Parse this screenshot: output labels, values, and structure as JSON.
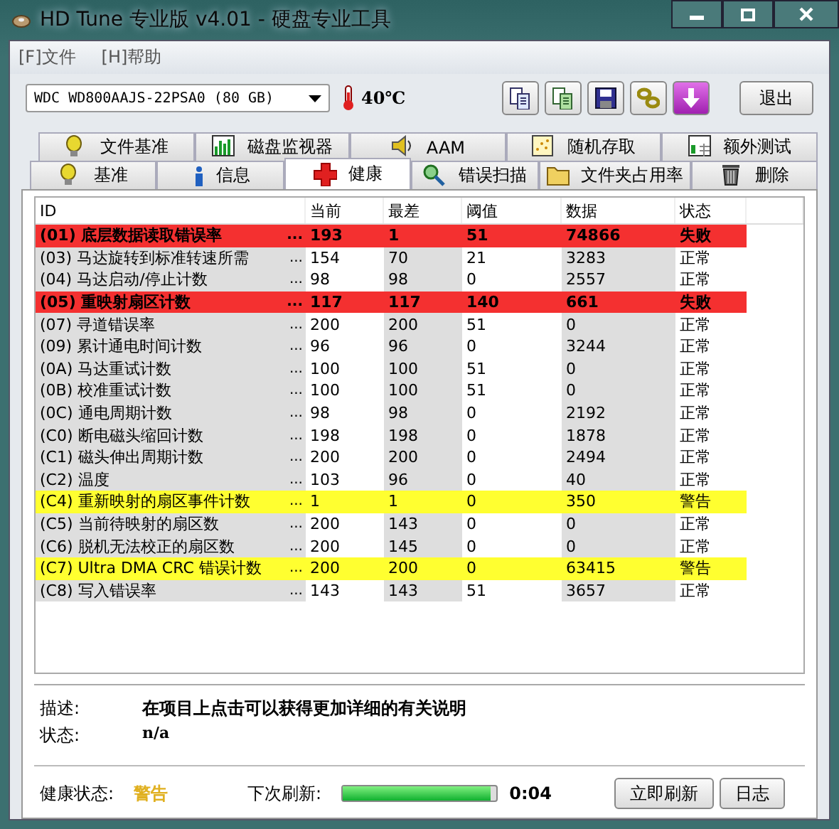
{
  "window": {
    "title": "HD Tune 专业版 v4.01 - 硬盘专业工具"
  },
  "menu": [
    "[F]文件",
    "[H]帮助"
  ],
  "toolbar": {
    "drive": "WDC WD800AAJS-22PSA0 (80 GB)",
    "temperature": "40℃",
    "exit_button": "退出"
  },
  "tabs_top": [
    {
      "label": "文件基准",
      "selected": false
    },
    {
      "label": "磁盘监视器",
      "selected": false
    },
    {
      "label": "AAM",
      "selected": false
    },
    {
      "label": "随机存取",
      "selected": false
    },
    {
      "label": "额外测试",
      "selected": false
    }
  ],
  "tabs_bottom": [
    {
      "label": "基准",
      "selected": false
    },
    {
      "label": "信息",
      "selected": false
    },
    {
      "label": "健康",
      "selected": true
    },
    {
      "label": "错误扫描",
      "selected": false
    },
    {
      "label": "文件夹占用率",
      "selected": false
    },
    {
      "label": "删除",
      "selected": false
    }
  ],
  "table": {
    "columns": [
      "ID",
      "当前",
      "最差",
      "阈值",
      "数据",
      "状态"
    ],
    "rows": [
      {
        "id": "(01) 底层数据读取错误率",
        "dots": "...",
        "current": "193",
        "worst": "1",
        "threshold": "51",
        "data": "74866",
        "status": "失败",
        "kind": "fail"
      },
      {
        "id": "(03) 马达旋转到标准转速所需",
        "dots": "...",
        "current": "154",
        "worst": "70",
        "threshold": "21",
        "data": "3283",
        "status": "正常",
        "kind": "normal"
      },
      {
        "id": "(04) 马达启动/停止计数",
        "dots": "...",
        "current": "98",
        "worst": "98",
        "threshold": "0",
        "data": "2557",
        "status": "正常",
        "kind": "normal"
      },
      {
        "id": "(05) 重映射扇区计数",
        "dots": "...",
        "current": "117",
        "worst": "117",
        "threshold": "140",
        "data": "661",
        "status": "失败",
        "kind": "fail"
      },
      {
        "id": "(07) 寻道错误率",
        "dots": "...",
        "current": "200",
        "worst": "200",
        "threshold": "51",
        "data": "0",
        "status": "正常",
        "kind": "normal"
      },
      {
        "id": "(09) 累计通电时间计数",
        "dots": "...",
        "current": "96",
        "worst": "96",
        "threshold": "0",
        "data": "3244",
        "status": "正常",
        "kind": "normal"
      },
      {
        "id": "(0A) 马达重试计数",
        "dots": "...",
        "current": "100",
        "worst": "100",
        "threshold": "51",
        "data": "0",
        "status": "正常",
        "kind": "normal"
      },
      {
        "id": "(0B) 校准重试计数",
        "dots": "...",
        "current": "100",
        "worst": "100",
        "threshold": "51",
        "data": "0",
        "status": "正常",
        "kind": "normal"
      },
      {
        "id": "(0C) 通电周期计数",
        "dots": "...",
        "current": "98",
        "worst": "98",
        "threshold": "0",
        "data": "2192",
        "status": "正常",
        "kind": "normal"
      },
      {
        "id": "(C0) 断电磁头缩回计数",
        "dots": "...",
        "current": "198",
        "worst": "198",
        "threshold": "0",
        "data": "1878",
        "status": "正常",
        "kind": "normal"
      },
      {
        "id": "(C1) 磁头伸出周期计数",
        "dots": "...",
        "current": "200",
        "worst": "200",
        "threshold": "0",
        "data": "2494",
        "status": "正常",
        "kind": "normal"
      },
      {
        "id": "(C2) 温度",
        "dots": "...",
        "current": "103",
        "worst": "96",
        "threshold": "0",
        "data": "40",
        "status": "正常",
        "kind": "normal"
      },
      {
        "id": "(C4) 重新映射的扇区事件计数",
        "dots": "...",
        "current": "1",
        "worst": "1",
        "threshold": "0",
        "data": "350",
        "status": "警告",
        "kind": "warning"
      },
      {
        "id": "(C5) 当前待映射的扇区数",
        "dots": "...",
        "current": "200",
        "worst": "143",
        "threshold": "0",
        "data": "0",
        "status": "正常",
        "kind": "normal"
      },
      {
        "id": "(C6) 脱机无法校正的扇区数",
        "dots": "...",
        "current": "200",
        "worst": "145",
        "threshold": "0",
        "data": "0",
        "status": "正常",
        "kind": "normal"
      },
      {
        "id": "(C7) Ultra DMA CRC 错误计数",
        "dots": "...",
        "current": "200",
        "worst": "200",
        "threshold": "0",
        "data": "63415",
        "status": "警告",
        "kind": "warning"
      },
      {
        "id": "(C8) 写入错误率",
        "dots": "...",
        "current": "143",
        "worst": "143",
        "threshold": "51",
        "data": "3657",
        "status": "正常",
        "kind": "normal"
      }
    ]
  },
  "details": {
    "description_label": "描述:",
    "description": "在项目上点击可以获得更加详细的有关说明",
    "status_label": "状态:",
    "status": "n/a"
  },
  "footer": {
    "health_label": "健康状态:",
    "health": "警告",
    "refresh_label": "下次刷新:",
    "refresh": {
      "level": 0.96
    },
    "countdown": "0:04",
    "buttons": [
      "立即刷新",
      "日志"
    ]
  }
}
